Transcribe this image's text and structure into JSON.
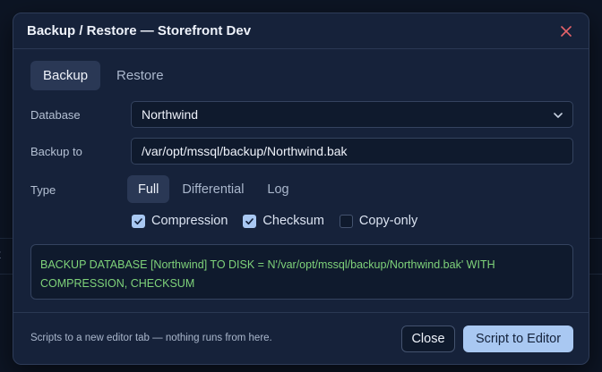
{
  "dialog": {
    "title": "Backup / Restore — Storefront Dev",
    "close_icon": "close-icon"
  },
  "tabs": [
    {
      "label": "Backup",
      "active": true
    },
    {
      "label": "Restore",
      "active": false
    }
  ],
  "form": {
    "database_label": "Database",
    "database_value": "Northwind",
    "backup_to_label": "Backup to",
    "backup_to_value": "/var/opt/mssql/backup/Northwind.bak",
    "type_label": "Type",
    "type_options": [
      {
        "label": "Full",
        "selected": true
      },
      {
        "label": "Differential",
        "selected": false
      },
      {
        "label": "Log",
        "selected": false
      }
    ],
    "options": [
      {
        "label": "Compression",
        "checked": true
      },
      {
        "label": "Checksum",
        "checked": true
      },
      {
        "label": "Copy-only",
        "checked": false
      }
    ]
  },
  "script_preview": {
    "line1": "BACKUP DATABASE [Northwind] TO DISK = N'/var/opt/mssql/backup/Northwind.bak' WITH",
    "line2": "COMPRESSION, CHECKSUM"
  },
  "footer": {
    "hint": "Scripts to a new editor tab — nothing runs from here.",
    "close_label": "Close",
    "primary_label": "Script to Editor"
  },
  "colors": {
    "accent": "#a9c8f2",
    "sql_text": "#7fd37a",
    "close_icon": "#e8636a"
  }
}
